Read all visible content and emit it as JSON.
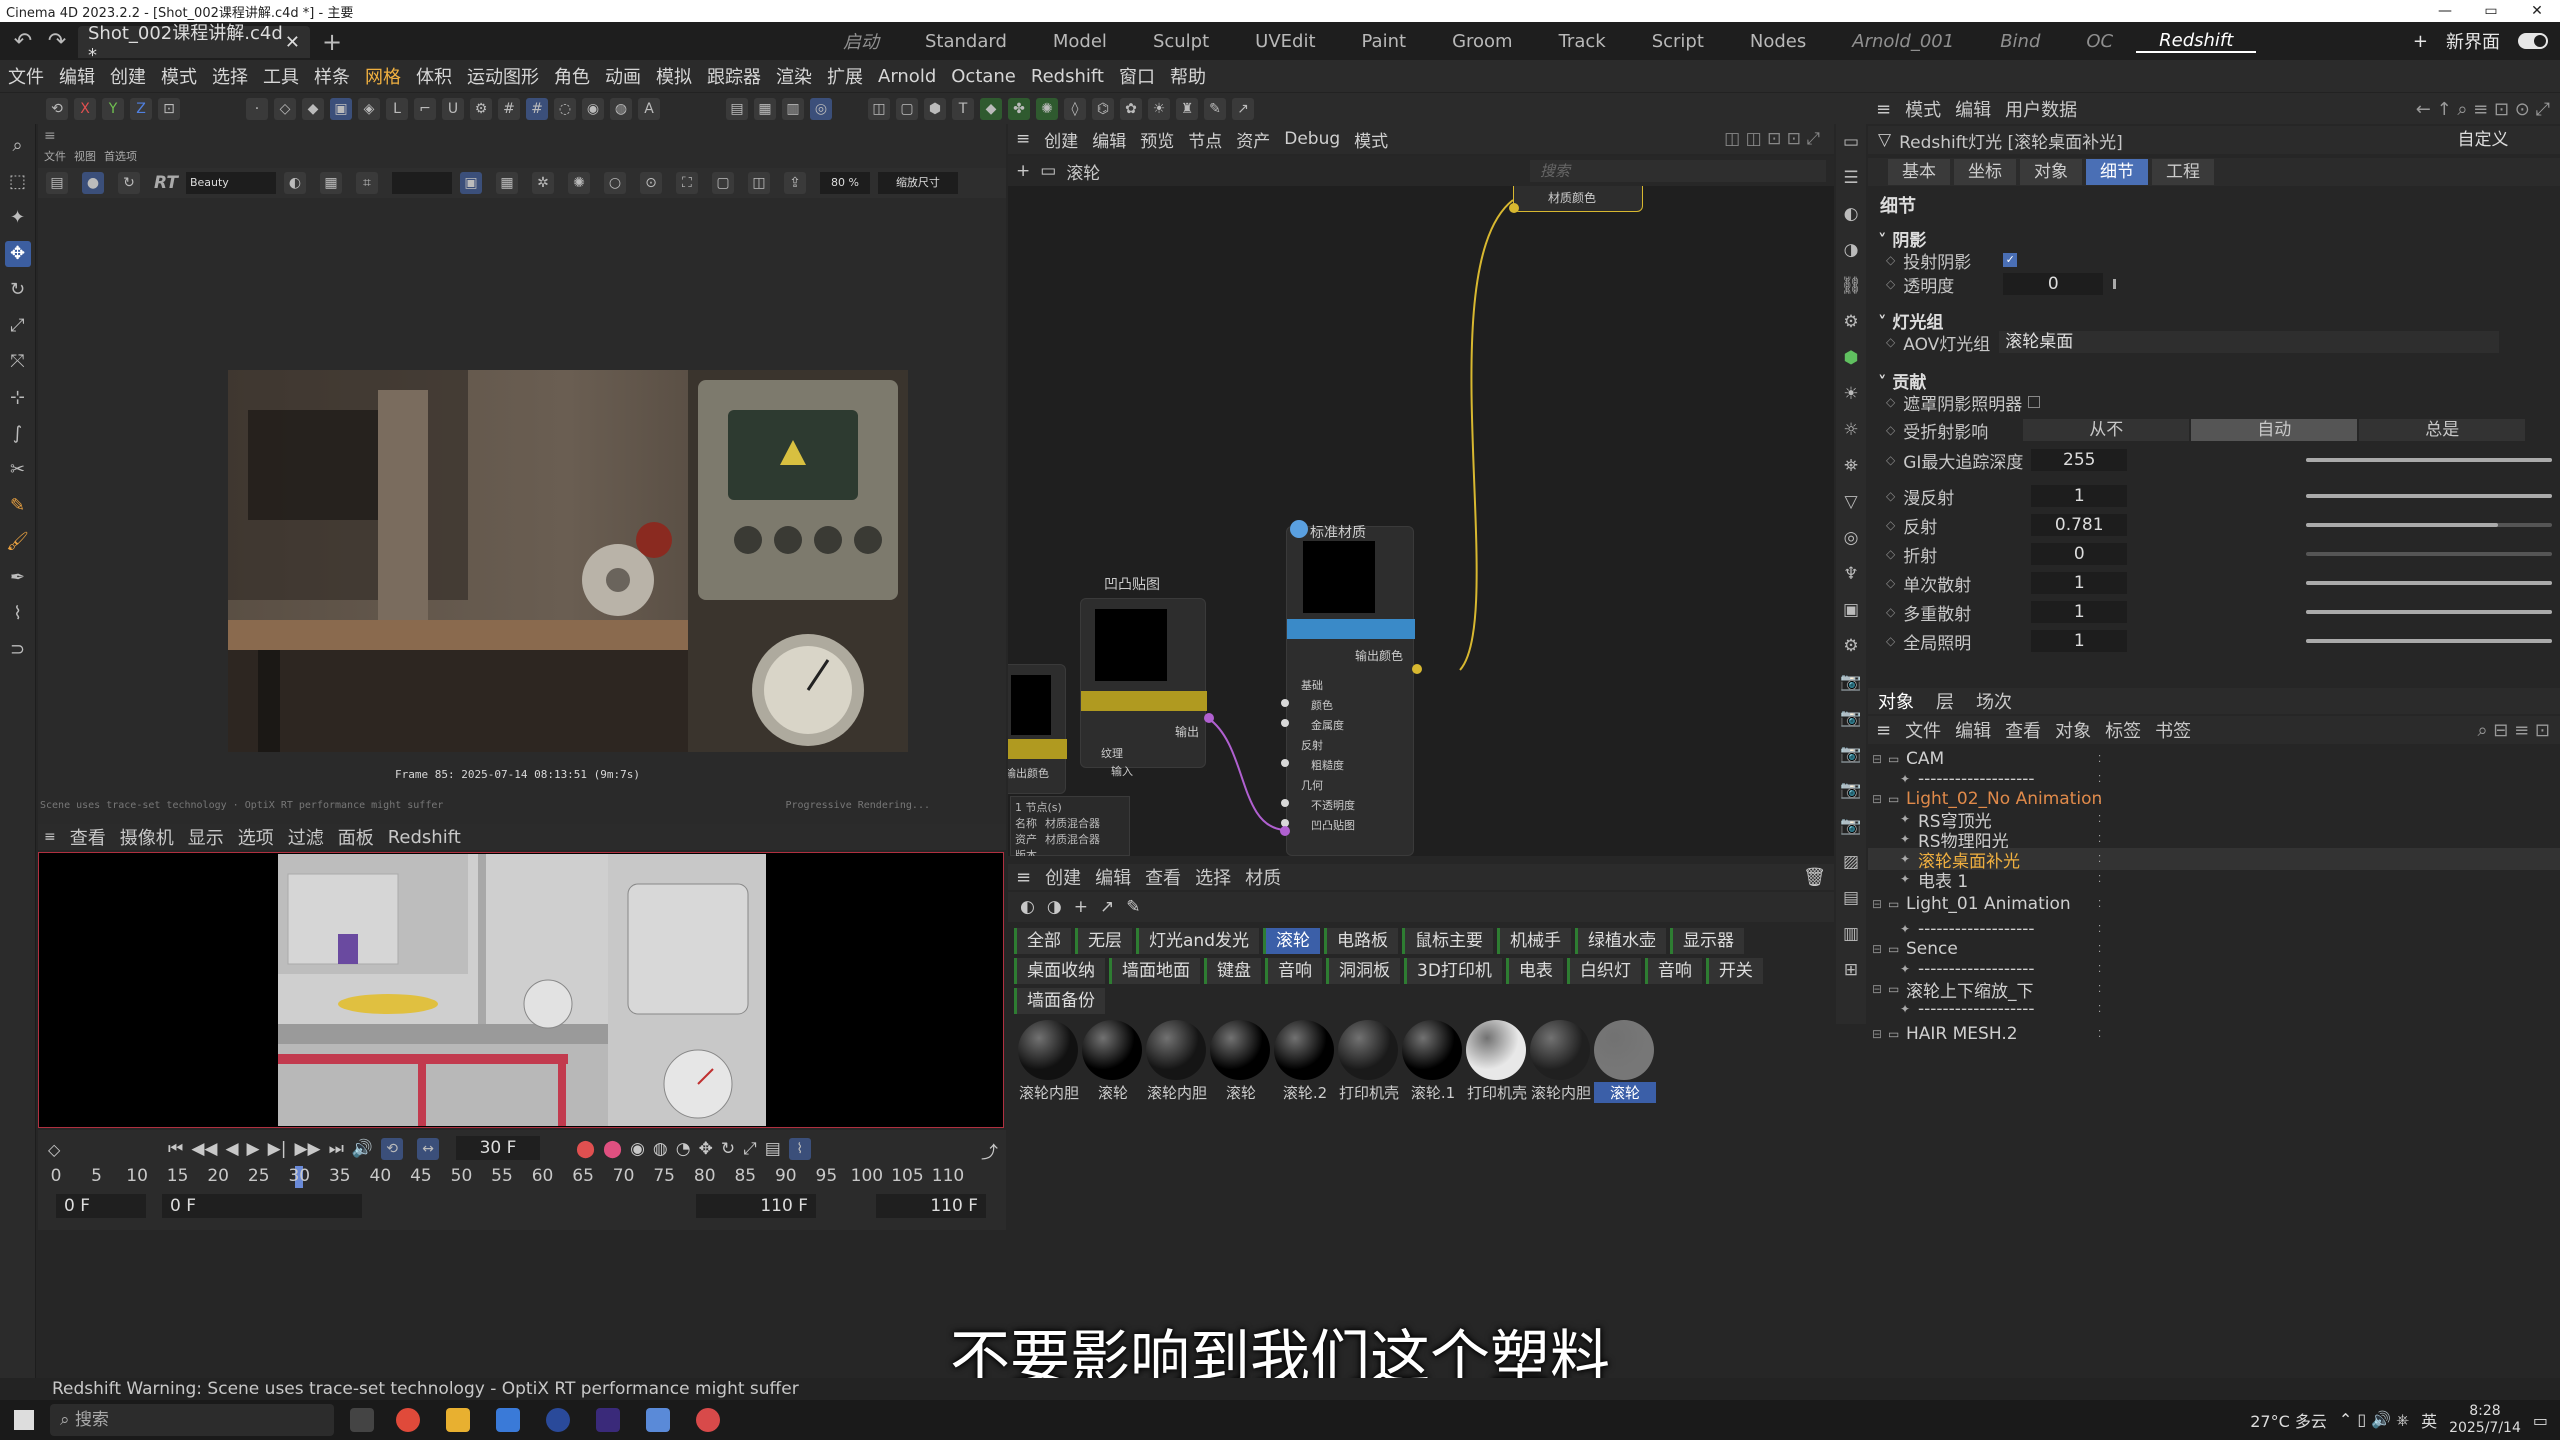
{
  "window": {
    "title": "Cinema 4D 2023.2.2 - [Shot_002课程讲解.c4d *] - 主要"
  },
  "tabs": {
    "doc_label": "Shot_002课程讲解.c4d *",
    "close": "✕",
    "add": "+"
  },
  "layouts": [
    "启动",
    "Standard",
    "Model",
    "Sculpt",
    "UVEdit",
    "Paint",
    "Groom",
    "Track",
    "Script",
    "Nodes",
    "Arnold_001",
    "Bind",
    "OC",
    "Redshift"
  ],
  "layouts_active": "Redshift",
  "topright": {
    "new_ui": "新界面",
    "plus": "+"
  },
  "menu": [
    "文件",
    "编辑",
    "创建",
    "模式",
    "选择",
    "工具",
    "样条",
    "网格",
    "体积",
    "运动图形",
    "角色",
    "动画",
    "模拟",
    "跟踪器",
    "渲染",
    "扩展",
    "Arnold",
    "Octane",
    "Redshift",
    "窗口",
    "帮助"
  ],
  "menu_highlight": "网格",
  "viewport": {
    "header_items": [
      "文件",
      "视图",
      "首选项"
    ],
    "rv_mode": "RT",
    "beauty": "Beauty",
    "zoom": "80 %",
    "fit": "缩放尺寸",
    "frame_info": "Frame  85:  2025-07-14  08:13:51  (9m:7s)",
    "status_left": "Scene uses trace-set technology · OptiX RT performance might suffer",
    "status_right": "Progressive Rendering..."
  },
  "vp2menu": [
    "查看",
    "摄像机",
    "显示",
    "选项",
    "过滤",
    "面板",
    "Redshift"
  ],
  "timeline": {
    "current_frame": "30 F",
    "ticks": [
      "0",
      "5",
      "10",
      "15",
      "20",
      "25",
      "30",
      "35",
      "40",
      "45",
      "50",
      "55",
      "60",
      "65",
      "70",
      "75",
      "80",
      "85",
      "90",
      "95",
      "100",
      "105",
      "110"
    ],
    "start": "0 F",
    "start2": "0 F",
    "end": "110 F",
    "end2": "110 F"
  },
  "node_editor": {
    "menu": [
      "创建",
      "编辑",
      "预览",
      "节点",
      "资产",
      "Debug",
      "模式"
    ],
    "breadcrumb": "滚轮",
    "search_placeholder": "搜索",
    "node_top": "材质颜色",
    "node_std": "标准材质",
    "node_std_out": "输出颜色",
    "node_std_sections": [
      "基础",
      "颜色",
      "金属度",
      "反射",
      "粗糙度",
      "几何",
      "不透明度",
      "凹凸贴图"
    ],
    "node_bump": "凹凸贴图",
    "node_bump_out": "输出",
    "node_bump_in": [
      "纹理",
      "输入"
    ],
    "node_left_out": "输出颜色",
    "info_lines": [
      "1 节点(s)",
      "名称",
      "资产",
      "版本"
    ],
    "info_vals": [
      "材质混合器",
      "材质混合器"
    ]
  },
  "material": {
    "menu": [
      "创建",
      "编辑",
      "查看",
      "选择",
      "材质"
    ],
    "filters": [
      "全部",
      "无层",
      "灯光and发光",
      "滚轮",
      "电路板",
      "鼠标主要",
      "机械手",
      "绿植水壶",
      "显示器",
      "桌面收纳",
      "墙面地面",
      "键盘",
      "音响",
      "洞洞板",
      "3D打印机",
      "电表",
      "白织灯",
      "音响",
      "开关",
      "墙面备份"
    ],
    "filter_active": "滚轮",
    "items": [
      {
        "label": "滚轮内胆",
        "color": "#111"
      },
      {
        "label": "滚轮",
        "color": "#000"
      },
      {
        "label": "滚轮内胆",
        "color": "#151515"
      },
      {
        "label": "滚轮",
        "color": "#000"
      },
      {
        "label": "滚轮.2",
        "color": "#000"
      },
      {
        "label": "打印机壳",
        "color": "#1a1a1a"
      },
      {
        "label": "滚轮.1",
        "color": "#000"
      },
      {
        "label": "打印机壳",
        "color": "#e8e8e8"
      },
      {
        "label": "滚轮内胆",
        "color": "#202020"
      },
      {
        "label": "滚轮",
        "color": "#777"
      }
    ]
  },
  "attributes": {
    "menu": [
      "模式",
      "编辑",
      "用户数据"
    ],
    "title": "Redshift灯光 [滚轮桌面补光]",
    "preset": "自定义",
    "tabs": [
      "基本",
      "坐标",
      "对象",
      "细节",
      "工程"
    ],
    "tab_active": "细节",
    "heading": "细节",
    "shadow_section": "阴影",
    "cast_shadow": "投射阴影",
    "transparency": "透明度",
    "transparency_val": "0",
    "lightgroup_section": "灯光组",
    "aov_label": "AOV灯光组",
    "aov_val": "滚轮桌面",
    "contrib_section": "贡献",
    "occl_label": "遮罩阴影照明器",
    "refl_label": "受折射影响",
    "refl_opts": [
      "从不",
      "自动",
      "总是"
    ],
    "refl_active": "自动",
    "rows": [
      {
        "label": "GI最大追踪深度",
        "val": "255",
        "frac": 1.0
      },
      {
        "label": "漫反射",
        "val": "1",
        "frac": 1.0
      },
      {
        "label": "反射",
        "val": "0.781",
        "frac": 0.781
      },
      {
        "label": "折射",
        "val": "0",
        "frac": 0.0
      },
      {
        "label": "单次散射",
        "val": "1",
        "frac": 1.0
      },
      {
        "label": "多重散射",
        "val": "1",
        "frac": 1.0
      },
      {
        "label": "全局照明",
        "val": "1",
        "frac": 1.0
      }
    ]
  },
  "objects": {
    "tabs": [
      "对象",
      "层",
      "场次"
    ],
    "menu": [
      "文件",
      "编辑",
      "查看",
      "对象",
      "标签",
      "书签"
    ],
    "rows": [
      {
        "name": "CAM",
        "indent": 0,
        "color": "#cfcfcf"
      },
      {
        "name": "-------------------",
        "indent": 1,
        "color": "#cfcfcf"
      },
      {
        "name": "Light_02_No Animation",
        "indent": 0,
        "color": "#e08a4a"
      },
      {
        "name": "RS穹顶光",
        "indent": 1,
        "color": "#cfcfcf"
      },
      {
        "name": "RS物理阳光",
        "indent": 1,
        "color": "#cfcfcf"
      },
      {
        "name": "滚轮桌面补光",
        "indent": 1,
        "color": "#f0b040"
      },
      {
        "name": "电表 1",
        "indent": 1,
        "color": "#cfcfcf"
      },
      {
        "name": "Light_01 Animation",
        "indent": 0,
        "color": "#cfcfcf"
      },
      {
        "name": "-------------------",
        "indent": 1,
        "color": "#cfcfcf"
      },
      {
        "name": "Sence",
        "indent": 0,
        "color": "#cfcfcf"
      },
      {
        "name": "-------------------",
        "indent": 1,
        "color": "#cfcfcf"
      },
      {
        "name": "滚轮上下缩放_下",
        "indent": 0,
        "color": "#cfcfcf"
      },
      {
        "name": "-------------------",
        "indent": 1,
        "color": "#cfcfcf"
      },
      {
        "name": "HAIR MESH.2",
        "indent": 0,
        "color": "#cfcfcf"
      }
    ]
  },
  "status": "Redshift Warning: Scene uses trace-set technology - OptiX RT performance might suffer",
  "subtitle": "不要影响到我们这个塑料",
  "taskbar": {
    "search": "搜索",
    "weather": "27°C 多云",
    "lang": "英",
    "time": "8:28",
    "date": "2025/7/14"
  },
  "colors": {
    "accent": "#3b5fa8",
    "highlight": "#f0b040",
    "panel": "#2b2b2b"
  }
}
